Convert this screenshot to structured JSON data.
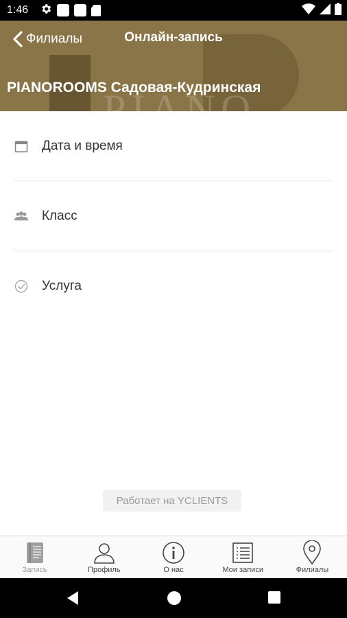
{
  "status_bar": {
    "time": "1:46",
    "icons": [
      "gear-icon",
      "notification-square-icon",
      "notification-square-icon",
      "sd-card-icon",
      "wifi-icon",
      "signal-icon",
      "battery-icon"
    ]
  },
  "header": {
    "back_label": "Филиалы",
    "title": "Онлайн-запись",
    "branch_name": "PIANOROOMS Садовая-Кудринская",
    "background_color": "#8a7548",
    "decor_text": "PIANO"
  },
  "menu": {
    "items": [
      {
        "label": "Дата и время",
        "icon": "calendar-icon"
      },
      {
        "label": "Класс",
        "icon": "people-icon"
      },
      {
        "label": "Услуга",
        "icon": "check-circle-icon"
      }
    ]
  },
  "powered_by": "Работает на YCLIENTS",
  "tabs": [
    {
      "label": "Запись",
      "icon": "book-icon",
      "active": true
    },
    {
      "label": "Профиль",
      "icon": "profile-icon",
      "active": false
    },
    {
      "label": "О нас",
      "icon": "info-icon",
      "active": false
    },
    {
      "label": "Мои записи",
      "icon": "list-icon",
      "active": false
    },
    {
      "label": "Филиалы",
      "icon": "location-pin-icon",
      "active": false
    }
  ],
  "nav_bar": {
    "buttons": [
      "back-triangle-icon",
      "home-circle-icon",
      "recents-square-icon"
    ]
  }
}
